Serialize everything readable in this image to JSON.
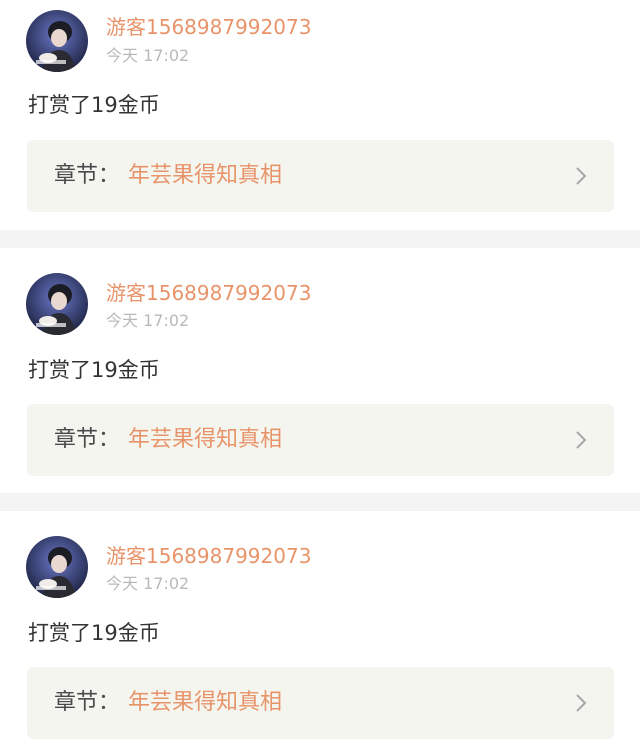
{
  "feed": {
    "entries": [
      {
        "username": "游客1568987992073",
        "time": "今天 17:02",
        "action": "打赏了19金币",
        "chapter_label": "章节：",
        "chapter_title": "年芸果得知真相"
      },
      {
        "username": "游客1568987992073",
        "time": "今天 17:02",
        "action": "打赏了19金币",
        "chapter_label": "章节：",
        "chapter_title": "年芸果得知真相"
      },
      {
        "username": "游客1568987992073",
        "time": "今天 17:02",
        "action": "打赏了19金币",
        "chapter_label": "章节：",
        "chapter_title": "年芸果得知真相"
      }
    ]
  },
  "icons": {
    "avatar": "user-avatar-photo",
    "chapter_arrow": "chevron-right-icon"
  },
  "colors": {
    "accent": "#e8946a",
    "text": "#333333",
    "muted": "#b9b9b9",
    "chapter_bg": "#f5f5f0",
    "divider": "#f4f4f4"
  }
}
